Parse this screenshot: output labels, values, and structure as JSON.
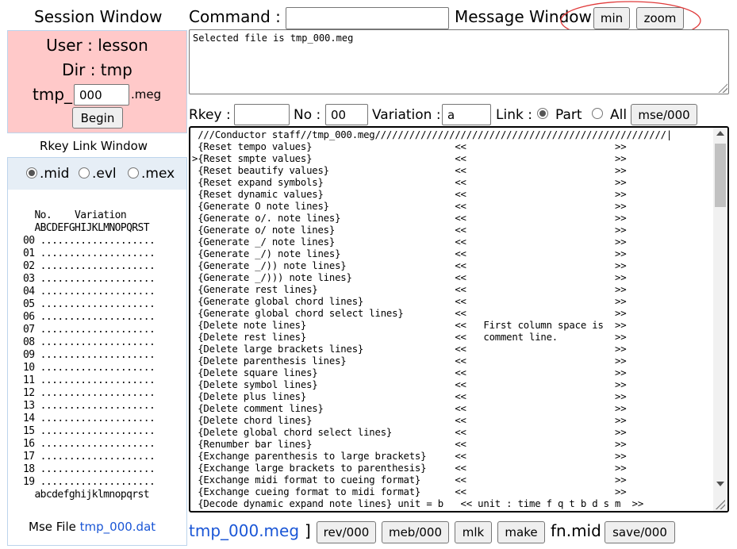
{
  "session": {
    "title": "Session Window",
    "user_label": "User : lesson",
    "dir_label": "Dir : tmp",
    "file_prefix": "tmp_",
    "file_number": "000",
    "file_ext": ".meg",
    "begin_label": "Begin"
  },
  "command": {
    "label": "Command :",
    "value": ""
  },
  "message_window": {
    "title": "Message Window",
    "min_label": "min",
    "zoom_label": "zoom",
    "text": "Selected file is tmp_000.meg"
  },
  "rkey_window": {
    "title": "Rkey Link Window",
    "radio_options": [
      ".mid",
      ".evl",
      ".mex"
    ],
    "selected": ".mid",
    "grid_text": "  No.    Variation\n  ABCDEFGHIJKLMNOPQRST\n00 ....................\n01 ....................\n02 ....................\n03 ....................\n04 ....................\n05 ....................\n06 ....................\n07 ....................\n08 ....................\n09 ....................\n10 ....................\n11 ....................\n12 ....................\n13 ....................\n14 ....................\n15 ....................\n16 ....................\n17 ....................\n18 ....................\n19 ....................\n  abcdefghijklmnopqrst",
    "mse_file_label": "Mse File",
    "mse_file_name": "tmp_000.dat"
  },
  "rkey_bar": {
    "rkey_label": "Rkey :",
    "rkey_value": "",
    "no_label": "No :",
    "no_value": "00",
    "variation_label": "Variation :",
    "variation_value": "a",
    "link_label": "Link :",
    "part_label": "Part",
    "all_label": "All",
    "selected": "Part",
    "mse_button": "mse/000"
  },
  "editor": {
    "text": " ///Conductor staff//tmp_000.meg///////////////////////////////////////////////////|\n {Reset tempo values}                         <<                          >>\n>{Reset smpte values}                         <<                          >>\n {Reset beautify values}                      <<                          >>\n {Reset expand symbols}                       <<                          >>\n {Reset dynamic values}                       <<                          >>\n {Generate O note lines}                      <<                          >>\n {Generate o/. note lines}                    <<                          >>\n {Generate o/ note lines}                     <<                          >>\n {Generate _/ note lines}                     <<                          >>\n {Generate _/) note lines}                    <<                          >>\n {Generate _/)) note lines}                   <<                          >>\n {Generate _/))) note lines}                  <<                          >>\n {Generate rest lines}                        <<                          >>\n {Generate global chord lines}                <<                          >>\n {Generate global chord select lines}         <<                          >>\n {Delete note lines}                          <<   First column space is  >>\n {Delete rest lines}                          <<   comment line.          >>\n {Delete large brackets lines}                <<                          >>\n {Delete parenthesis lines}                   <<                          >>\n {Delete square lines}                        <<                          >>\n {Delete symbol lines}                        <<                          >>\n {Delete plus lines}                          <<                          >>\n {Delete comment lines}                       <<                          >>\n {Delete chord lines}                         <<                          >>\n {Delete global chord select lines}           <<                          >>\n {Renumber bar lines}                         <<                          >>\n {Exchange parenthesis to large brackets}     <<                          >>\n {Exchange large brackets to parenthesis}     <<                          >>\n {Exchange midi format to cueing format}      <<                          >>\n {Exchange cueing format to midi format}      <<                          >>\n {Decode dynamic expand note lines} unit = b   << unit : time f q t b d s m  >>"
  },
  "bottom_bar": {
    "file_name": "tmp_000.meg",
    "bracket": "]",
    "rev_button": "rev/000",
    "meb_button": "meb/000",
    "mlk_button": "mlk",
    "make_button": "make",
    "fn_label": "fn.mid",
    "save_button": "save/000"
  },
  "colors": {
    "session_bg": "#ffc9c9",
    "link_blue": "#1a56d6",
    "highlight_ellipse": "#e03a3a"
  }
}
